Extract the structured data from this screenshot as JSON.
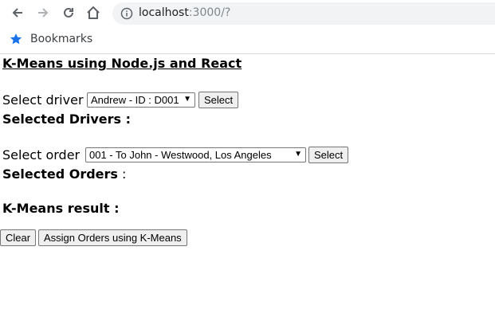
{
  "browser": {
    "url_host": "localhost",
    "url_path": ":3000/?",
    "bookmarks_label": "Bookmarks"
  },
  "page": {
    "title": "K-Means using Node.js and React",
    "driver": {
      "label": "Select driver :",
      "selected_value": "Andrew - ID : D001",
      "button_label": "Select",
      "selected_heading": "Selected Drivers",
      "selected_suffix": " :"
    },
    "order": {
      "label": "Select order :",
      "selected_value": "001 - To John - Westwood, Los Angeles",
      "button_label": "Select",
      "selected_heading": "Selected Orders",
      "selected_suffix": " :"
    },
    "result_heading": "K-Means result :",
    "clear_label": "Clear",
    "assign_label": "Assign Orders using K-Means"
  }
}
